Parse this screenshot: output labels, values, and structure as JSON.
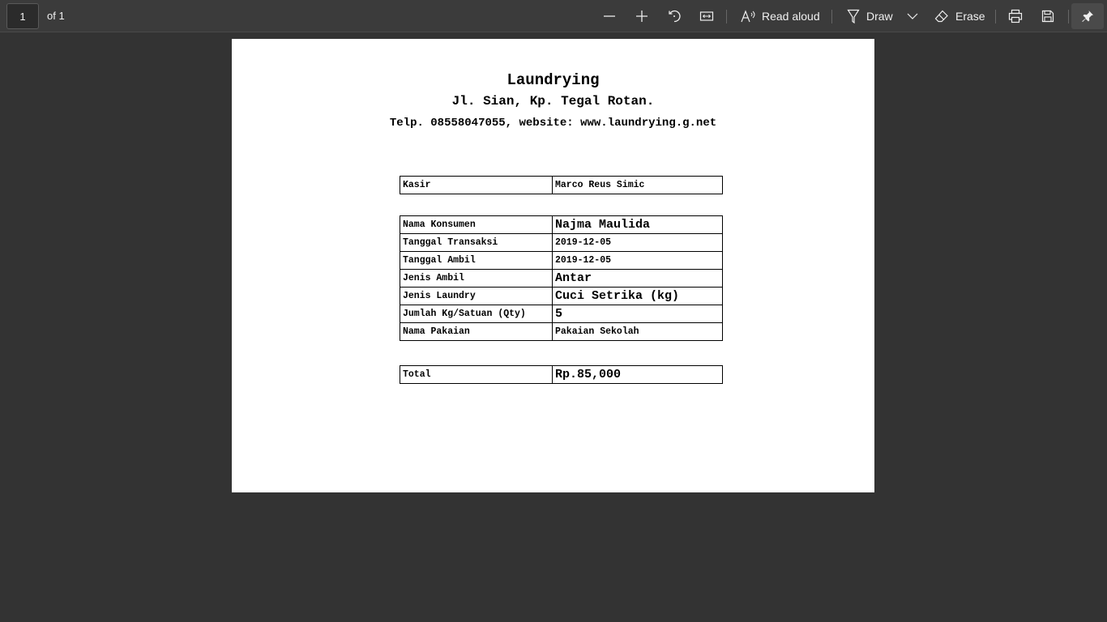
{
  "toolbar": {
    "page_number": "1",
    "page_count": "of 1",
    "read_aloud": "Read aloud",
    "draw": "Draw",
    "erase": "Erase"
  },
  "document": {
    "title": "Laundrying",
    "address": "Jl. Sian, Kp. Tegal Rotan.",
    "contact": "Telp. 08558047055, website: www.laundrying.g.net",
    "cashier": {
      "label": "Kasir",
      "value": "Marco Reus Simic"
    },
    "details": [
      {
        "label": "Nama Konsumen",
        "value": "Najma Maulida"
      },
      {
        "label": "Tanggal Transaksi",
        "value": "2019-12-05"
      },
      {
        "label": "Tanggal Ambil",
        "value": "2019-12-05"
      },
      {
        "label": "Jenis Ambil",
        "value": "Antar"
      },
      {
        "label": "Jenis Laundry",
        "value": "Cuci Setrika (kg)"
      },
      {
        "label": "Jumlah Kg/Satuan (Qty)",
        "value": "5"
      },
      {
        "label": "Nama Pakaian",
        "value": "Pakaian Sekolah"
      }
    ],
    "total": {
      "label": "Total",
      "value": "Rp.85,000"
    }
  }
}
